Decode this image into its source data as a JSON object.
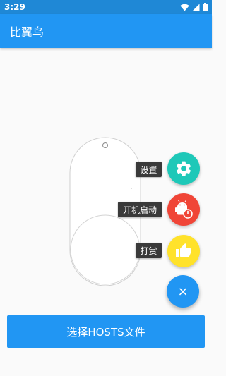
{
  "status_bar": {
    "time": "3:29",
    "icons": [
      "wifi-icon",
      "signal-icon",
      "battery-icon"
    ]
  },
  "app_bar": {
    "title": "比翼鸟"
  },
  "fab_menu": {
    "items": [
      {
        "label": "设置",
        "icon": "gear-icon",
        "color": "#1ec8b8"
      },
      {
        "label": "开机启动",
        "icon": "android-power-icon",
        "color": "#f04537"
      },
      {
        "label": "打赏",
        "icon": "thumbs-up-icon",
        "color": "#ffe22b"
      }
    ],
    "main_icon": "close-icon",
    "main_symbol": "×",
    "main_color": "#2196f3"
  },
  "select_button": {
    "label": "选择HOSTS文件"
  }
}
